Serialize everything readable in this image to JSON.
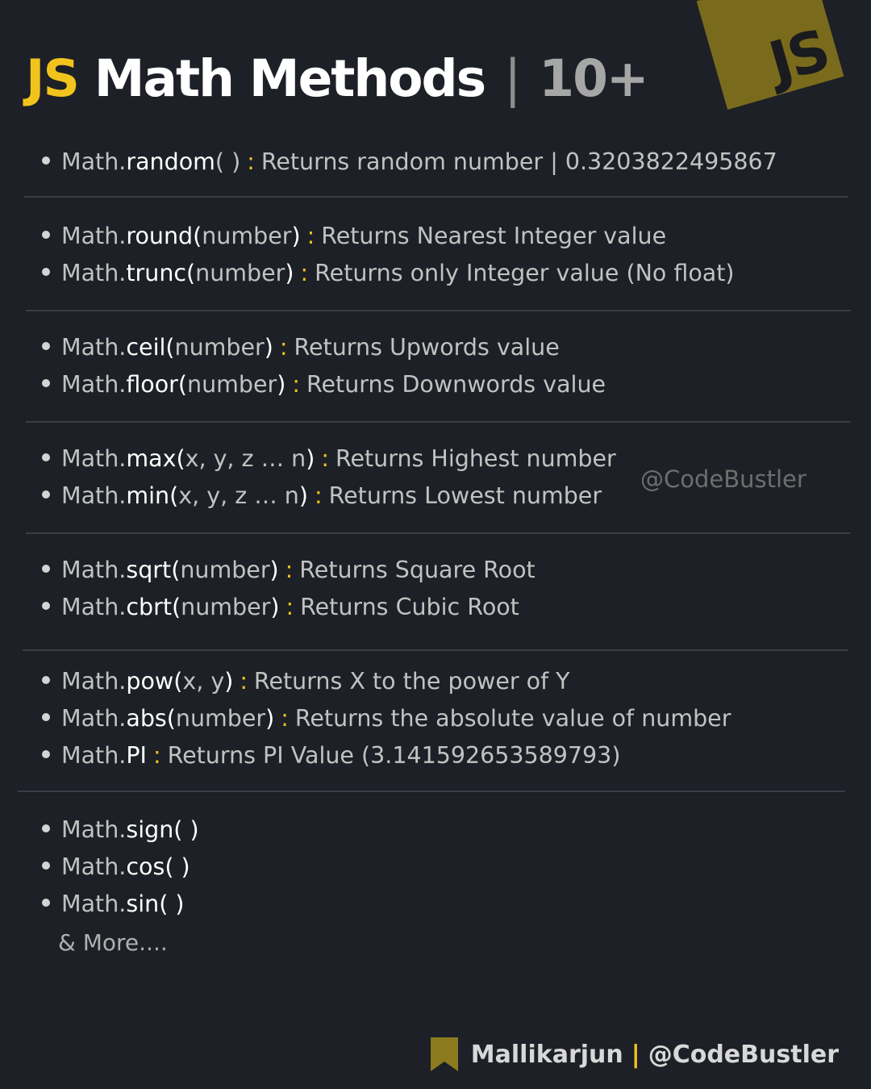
{
  "title": {
    "js": "JS",
    "main": "Math Methods",
    "sep": "|",
    "count": "10+"
  },
  "logo": {
    "text": "JS",
    "color": "#7a6b1c"
  },
  "accent": "#f2c31c",
  "groups": [
    [
      {
        "obj": "Math.",
        "fn": "random",
        "args": "( )",
        "colon": ":",
        "desc": "Returns random number | 0.3203822495867"
      }
    ],
    [
      {
        "obj": "Math.",
        "fn": "round(",
        "args": "number",
        "close": ")",
        "colon": ":",
        "desc": "Returns Nearest Integer value"
      },
      {
        "obj": "Math.",
        "fn": "trunc(",
        "args": "number",
        "close": ")",
        "colon": ":",
        "desc": "Returns only Integer value (No float)"
      }
    ],
    [
      {
        "obj": "Math.",
        "fn": "ceil(",
        "args": "number",
        "close": ")",
        "colon": ":",
        "desc": "Returns Upwords value"
      },
      {
        "obj": "Math.",
        "fn": "floor(",
        "args": "number",
        "close": ")",
        "colon": ":",
        "desc": "Returns Downwords value"
      }
    ],
    [
      {
        "obj": "Math.",
        "fn": "max(",
        "args": "x, y, z … n",
        "close": ")",
        "colon": ":",
        "desc": "Returns Highest number"
      },
      {
        "obj": "Math.",
        "fn": "min(",
        "args": "x, y, z … n",
        "close": ")",
        "colon": ":",
        "desc": "Returns Lowest number"
      }
    ],
    [
      {
        "obj": "Math.",
        "fn": "sqrt(",
        "args": "number",
        "close": ")",
        "colon": ":",
        "desc": "Returns Square Root"
      },
      {
        "obj": "Math.",
        "fn": "cbrt(",
        "args": "number",
        "close": ")",
        "colon": ":",
        "desc": "Returns Cubic Root"
      }
    ],
    [
      {
        "obj": "Math.",
        "fn": "pow(",
        "args": "x, y",
        "close": ")",
        "colon": ":",
        "desc": "Returns X to the power of Y"
      },
      {
        "obj": "Math.",
        "fn": "abs(",
        "args": "number",
        "close": ")",
        "colon": ":",
        "desc": "Returns the absolute value of number"
      },
      {
        "obj": "Math.",
        "fn": "PI",
        "args": "",
        "close": "",
        "colon": ":",
        "desc": "Returns PI Value (3.141592653589793)"
      }
    ],
    [
      {
        "obj": "Math.",
        "fn": "sign( )",
        "args": "",
        "close": "",
        "colon": "",
        "desc": ""
      },
      {
        "obj": "Math.",
        "fn": "cos( )",
        "args": "",
        "close": "",
        "colon": "",
        "desc": ""
      },
      {
        "obj": "Math.",
        "fn": "sin( )",
        "args": "",
        "close": "",
        "colon": "",
        "desc": ""
      }
    ]
  ],
  "more": "& More....",
  "watermark": "@CodeBustler",
  "footer": {
    "name": "Mallikarjun",
    "bar": "|",
    "handle": "@CodeBustler"
  }
}
